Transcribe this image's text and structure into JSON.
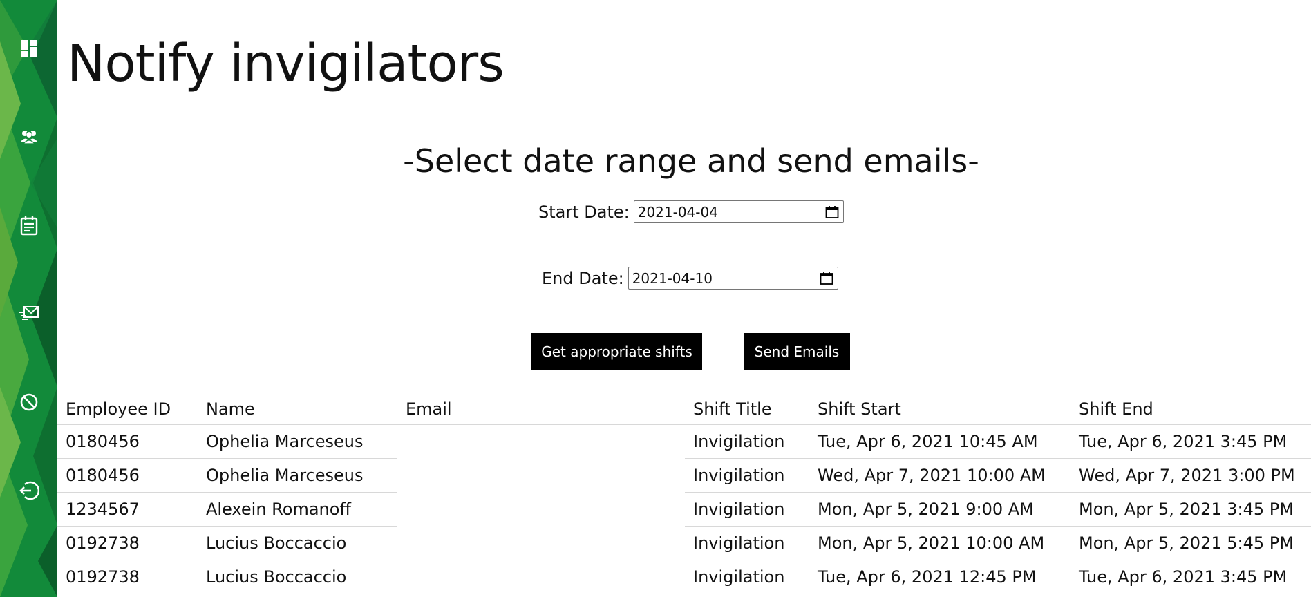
{
  "sidebar": {
    "items": [
      {
        "icon": "dashboard-icon"
      },
      {
        "icon": "users-icon"
      },
      {
        "icon": "calendar-icon"
      },
      {
        "icon": "mail-send-icon"
      },
      {
        "icon": "block-icon"
      },
      {
        "icon": "logout-icon"
      }
    ],
    "colors": {
      "dark": "#0b5f2a",
      "mid": "#128a3a",
      "light": "#5aaa3c"
    }
  },
  "page": {
    "title": "Notify invigilators",
    "subtitle": "-Select date range and send emails-"
  },
  "form": {
    "start_label": "Start Date:",
    "start_value": "2021-04-04",
    "end_label": "End Date:",
    "end_value": "2021-04-10",
    "get_shifts_label": "Get appropriate shifts",
    "send_emails_label": "Send Emails"
  },
  "table": {
    "headers": [
      "Employee ID",
      "Name",
      "Email",
      "Shift Title",
      "Shift Start",
      "Shift End"
    ],
    "rows": [
      {
        "employee_id": "0180456",
        "name": "Ophelia Marceseus",
        "email": "",
        "shift_title": "Invigilation",
        "shift_start": "Tue, Apr 6, 2021 10:45 AM",
        "shift_end": "Tue, Apr 6, 2021 3:45 PM"
      },
      {
        "employee_id": "0180456",
        "name": "Ophelia Marceseus",
        "email": "",
        "shift_title": "Invigilation",
        "shift_start": "Wed, Apr 7, 2021 10:00 AM",
        "shift_end": "Wed, Apr 7, 2021 3:00 PM"
      },
      {
        "employee_id": "1234567",
        "name": "Alexein Romanoff",
        "email": "",
        "shift_title": "Invigilation",
        "shift_start": "Mon, Apr 5, 2021 9:00 AM",
        "shift_end": "Mon, Apr 5, 2021 3:45 PM"
      },
      {
        "employee_id": "0192738",
        "name": "Lucius Boccaccio",
        "email": "",
        "shift_title": "Invigilation",
        "shift_start": "Mon, Apr 5, 2021 10:00 AM",
        "shift_end": "Mon, Apr 5, 2021 5:45 PM"
      },
      {
        "employee_id": "0192738",
        "name": "Lucius Boccaccio",
        "email": "",
        "shift_title": "Invigilation",
        "shift_start": "Tue, Apr 6, 2021 12:45 PM",
        "shift_end": "Tue, Apr 6, 2021 3:45 PM"
      }
    ]
  }
}
